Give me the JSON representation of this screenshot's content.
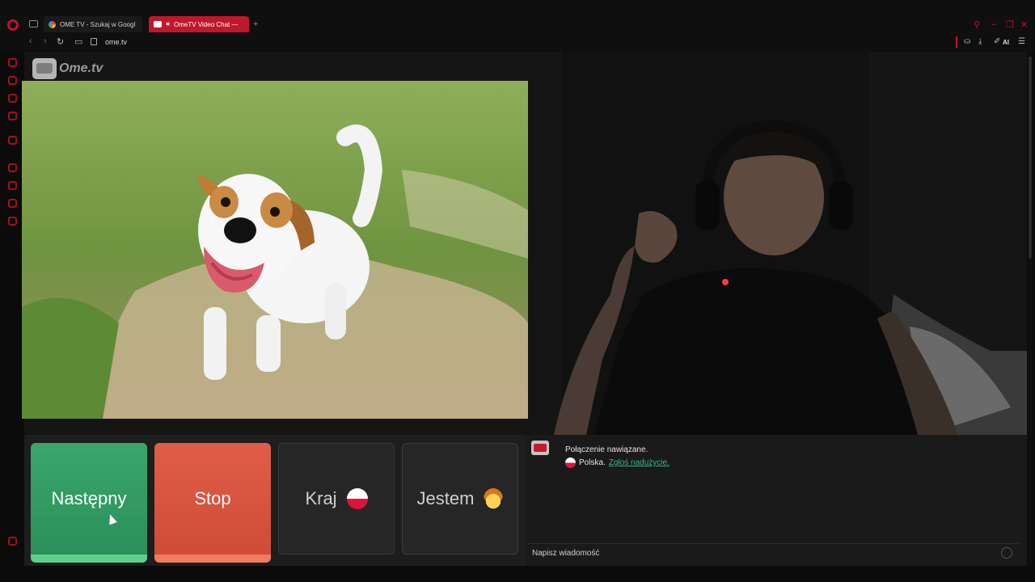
{
  "browser": {
    "tabs": [
      {
        "label": "OME TV - Szukaj w Googl",
        "active": false
      },
      {
        "label": "OmeTV Video Chat —",
        "active": true
      }
    ],
    "url": "ome.tv",
    "ai_label": "AI",
    "accent_color": "#c8102e"
  },
  "site": {
    "logo_text": "Ome.tv"
  },
  "controls": {
    "next_label": "Następny",
    "stop_label": "Stop",
    "country_label": "Kraj",
    "gender_label": "Jestem",
    "next_color": "#2f9a62",
    "stop_color": "#d9563f"
  },
  "chat": {
    "status": "Połączenie nawiązane.",
    "country": "Polska.",
    "report_link": "Zgłoś nadużycie.",
    "input_placeholder": "Napisz wiadomość"
  }
}
